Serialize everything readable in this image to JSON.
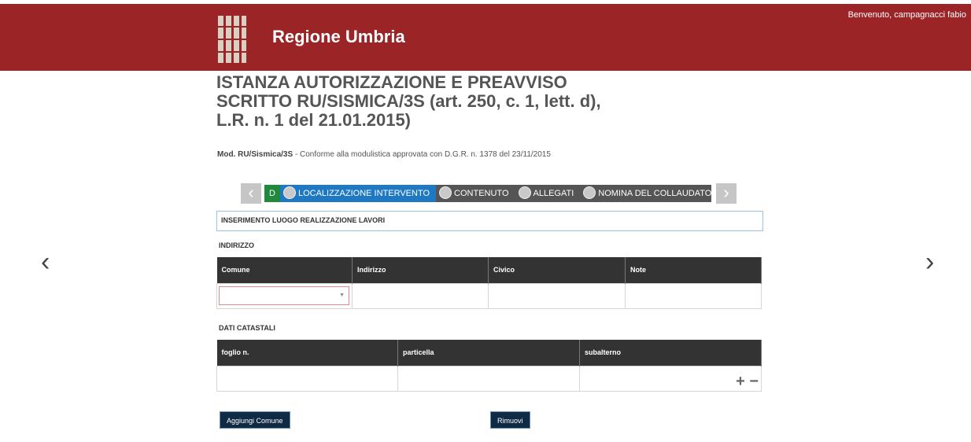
{
  "header": {
    "brand": "Regione Umbria",
    "welcome": "Benvenuto, campagnacci fabio"
  },
  "page": {
    "title": "ISTANZA AUTORIZZAZIONE E PREAVVISO SCRITTO RU/SISMICA/3S (art. 250, c. 1, lett. d), L.R. n. 1 del 21.01.2015)",
    "subtitle_bold": "Mod. RU/Sismica/3S",
    "subtitle_text": " - Conforme alla modulistica approvata con D.G.R. n. 1378 del  23/11/2015"
  },
  "wizard": {
    "prev": "‹",
    "next": "›",
    "steps": [
      {
        "label": "D"
      },
      {
        "label": "LOCALIZZAZIONE INTERVENTO"
      },
      {
        "label": "CONTENUTO"
      },
      {
        "label": "ALLEGATI"
      },
      {
        "label": "NOMINA DEL COLLAUDATORE"
      }
    ]
  },
  "section": {
    "title": "INSERIMENTO LUOGO REALIZZAZIONE LAVORI"
  },
  "indirizzo": {
    "label": "INDIRIZZO",
    "columns": [
      "Comune",
      "Indirizzo",
      "Civico",
      "Note"
    ],
    "comune_value": ""
  },
  "catastali": {
    "label": "DATI CATASTALI",
    "columns": [
      "foglio n.",
      "particella",
      "subalterno"
    ],
    "plus_minus": "+ −"
  },
  "buttons": {
    "add_comune": "Aggiungi Comune",
    "remove": "Rimuovi"
  },
  "nav": {
    "prev": "‹",
    "next": "›"
  }
}
